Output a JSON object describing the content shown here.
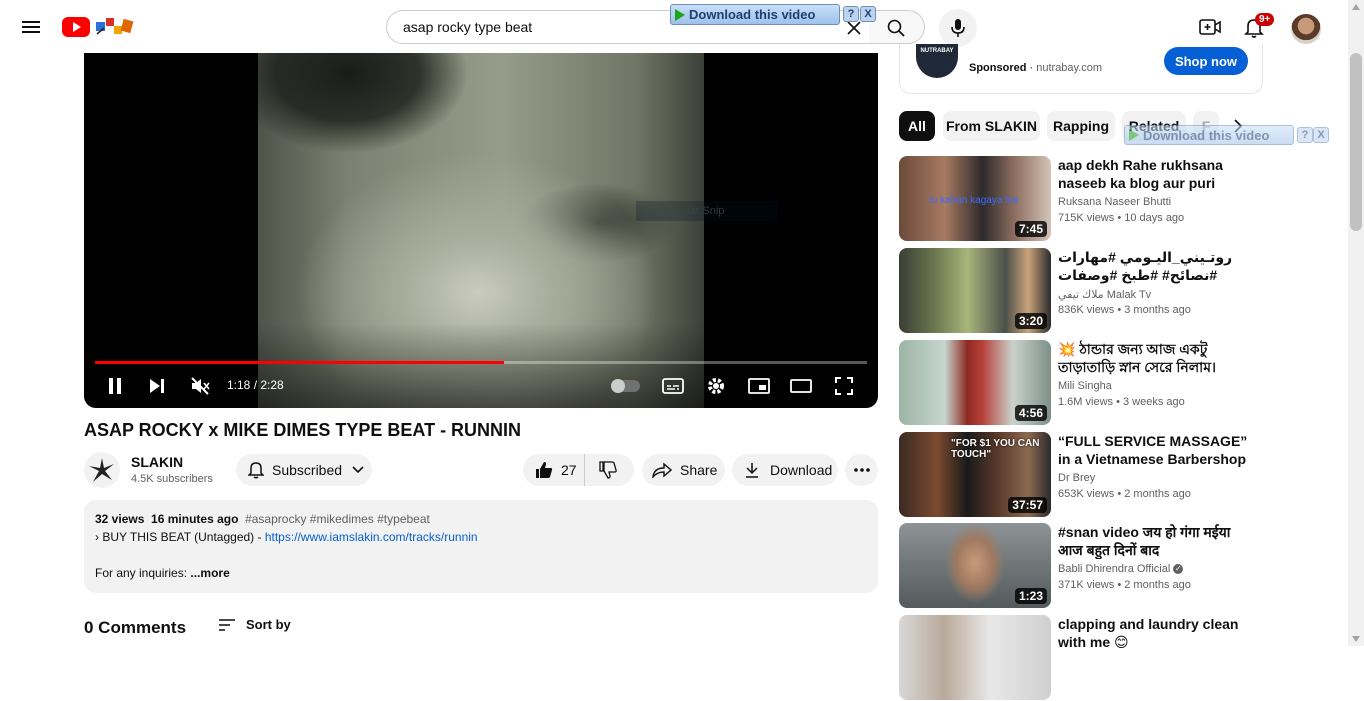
{
  "search": {
    "query": "asap rocky type beat"
  },
  "notifications": {
    "count": "9+"
  },
  "download_overlay": {
    "label": "Download this video",
    "help": "?",
    "close": "X"
  },
  "video": {
    "time_current": "1:18",
    "time_separator": " / ",
    "time_total": "2:28",
    "progress": 0.53,
    "buffered": 0.53,
    "ghost_text": "Rectangular Snip"
  },
  "title": "ASAP ROCKY x MIKE DIMES TYPE BEAT - RUNNIN",
  "channel": {
    "name": "SLAKIN",
    "subscribers": "4.5K subscribers",
    "subscribed_label": "Subscribed"
  },
  "actions": {
    "likes": "27",
    "share": "Share",
    "download": "Download"
  },
  "description": {
    "views": "32 views",
    "age": "16 minutes ago",
    "tags": "#asaprocky #mikedimes #typebeat",
    "line2_prefix": "› BUY THIS BEAT (Untagged) - ",
    "link": "https://www.iamslakin.com/tracks/runnin",
    "line3": "For any inquiries:",
    "more": "...more"
  },
  "comments": {
    "count": "0 Comments",
    "sort": "Sort by"
  },
  "ad": {
    "logo": "NUTRABAY",
    "sponsored": "Sponsored",
    "domain": "nutrabay.com",
    "shop": "Shop now"
  },
  "chips": [
    "All",
    "From SLAKIN",
    "Rapping",
    "Related",
    "F"
  ],
  "recommendations": [
    {
      "title": "aap dekh Rahe rukhsana naseeb ka blog aur puri video…",
      "channel": "Ruksana Naseer Bhutti",
      "views": "715K views",
      "age": "10 days ago",
      "duration": "7:45",
      "overlay": "tu kahan kagaya hai"
    },
    {
      "title": "روتـيني_اليـومي #مهارات #نصائح# #طبخ #وصفات #سهلة_وسريعة #صحية#…",
      "channel": "ملاك تيفي Malak Tv",
      "views": "836K views",
      "age": "3 months ago",
      "duration": "3:20"
    },
    {
      "title": "💥 ঠান্ডার জন্য আজ একটু তাড়াতাড়ি স্নান সেরে নিলাম।",
      "channel": "Mili Singha",
      "views": "1.6M views",
      "age": "3 weeks ago",
      "duration": "4:56"
    },
    {
      "title": "“FULL SERVICE MASSAGE” in a Vietnamese Barbershop in…",
      "channel": "Dr Brey",
      "views": "653K views",
      "age": "2 months ago",
      "duration": "37:57",
      "overlay": "\"FOR $1 YOU CAN TOUCH\""
    },
    {
      "title": "#snan video जय हो गंगा मईया आज बहुत दिनों बाद",
      "channel": "Babli Dhirendra Official",
      "views": "371K views",
      "age": "2 months ago",
      "duration": "1:23"
    },
    {
      "title": "clapping and laundry clean with me 😊",
      "channel": "",
      "views": "",
      "age": "",
      "duration": ""
    }
  ],
  "colors": {
    "accent": "#ff0000",
    "link": "#065fd4",
    "shop": "#065fd4"
  }
}
